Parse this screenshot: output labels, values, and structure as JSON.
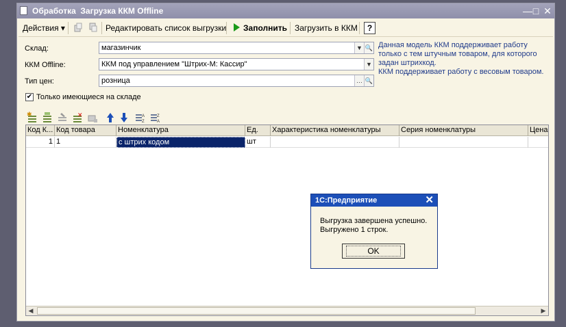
{
  "window": {
    "title": "Обработка  Загрузка ККМ Offline",
    "minimize": "—",
    "maximize": "□",
    "close": "✕"
  },
  "toolbar": {
    "actions": "Действия",
    "edit_list": "Редактировать список выгрузки",
    "fill": "Заполнить",
    "upload": "Загрузить в ККМ",
    "help": "?"
  },
  "form": {
    "warehouse_label": "Склад:",
    "warehouse_value": "магазинчик",
    "kkm_label": "ККМ Offline:",
    "kkm_value": "ККМ под управлением \"Штрих-М: Кассир\"",
    "price_label": "Тип цен:",
    "price_value": "розница",
    "only_stock_label": "Только имеющиеся на складе",
    "only_stock_checked": true
  },
  "note": {
    "line1": "Данная модель ККМ поддерживает работу",
    "line2": "только с тем штучным товаром, для которого",
    "line3": "задан штрихкод.",
    "line4": "ККМ поддерживает работу с весовым товаром."
  },
  "grid": {
    "columns": [
      "Код К...",
      "Код товара",
      "Номенклатура",
      "Ед.",
      "Характеристика номенклатуры",
      "Серия номенклатуры",
      "Цена"
    ],
    "rows": [
      [
        "1",
        "1",
        "с штрих кодом",
        "шт",
        "",
        "",
        ""
      ]
    ]
  },
  "dialog": {
    "title": "1С:Предприятие",
    "close": "✕",
    "line1": "Выгрузка завершена успешно.",
    "line2": "Выгружено 1 строк.",
    "ok": "OK"
  }
}
